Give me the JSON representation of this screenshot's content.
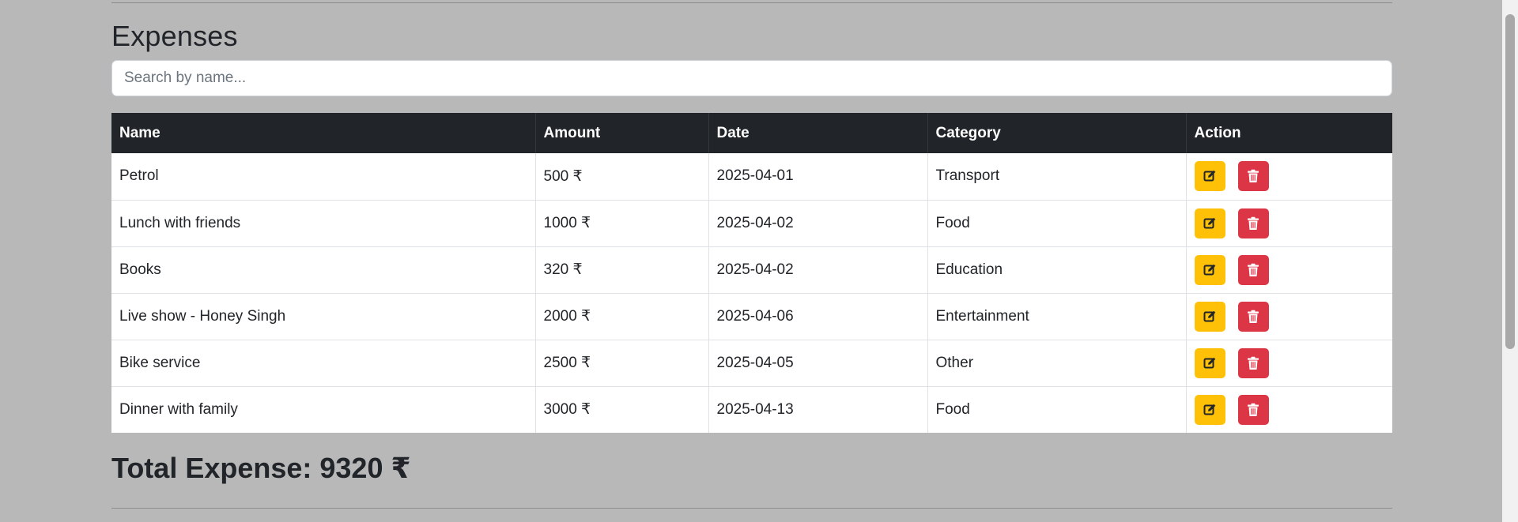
{
  "header": {
    "title": "Expenses"
  },
  "search": {
    "placeholder": "Search by name...",
    "value": ""
  },
  "table": {
    "columns": [
      "Name",
      "Amount",
      "Date",
      "Category",
      "Action"
    ],
    "rows": [
      {
        "name": "Petrol",
        "amount": "500 ₹",
        "date": "2025-04-01",
        "category": "Transport"
      },
      {
        "name": "Lunch with friends",
        "amount": "1000 ₹",
        "date": "2025-04-02",
        "category": "Food"
      },
      {
        "name": "Books",
        "amount": "320 ₹",
        "date": "2025-04-02",
        "category": "Education"
      },
      {
        "name": "Live show - Honey Singh",
        "amount": "2000 ₹",
        "date": "2025-04-06",
        "category": "Entertainment"
      },
      {
        "name": "Bike service",
        "amount": "2500 ₹",
        "date": "2025-04-05",
        "category": "Other"
      },
      {
        "name": "Dinner with family",
        "amount": "3000 ₹",
        "date": "2025-04-13",
        "category": "Food"
      }
    ]
  },
  "summary": {
    "total_label": "Total Expense: 9320 ₹"
  },
  "icons": {
    "edit": "edit-icon",
    "delete": "trash-icon"
  },
  "colors": {
    "page_background": "#b8b8b8",
    "table_header": "#212529",
    "edit_button": "#ffc107",
    "delete_button": "#dc3545"
  }
}
